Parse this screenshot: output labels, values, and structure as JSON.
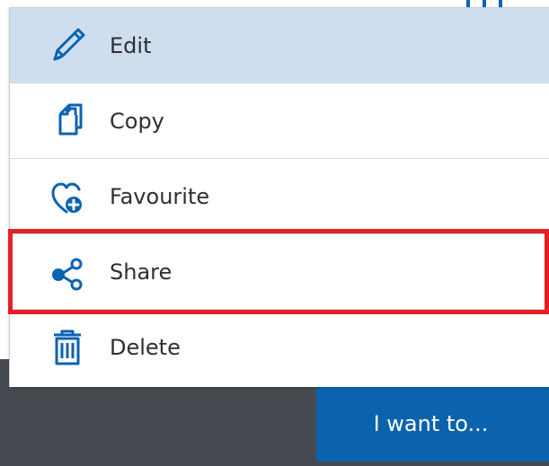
{
  "menu": {
    "items": [
      {
        "label": "Edit",
        "icon": "pencil-icon"
      },
      {
        "label": "Copy",
        "icon": "copy-icon"
      },
      {
        "label": "Favourite",
        "icon": "heart-plus-icon"
      },
      {
        "label": "Share",
        "icon": "share-icon"
      },
      {
        "label": "Delete",
        "icon": "trash-icon"
      }
    ]
  },
  "action_button": {
    "label": "I want to..."
  },
  "colors": {
    "accent": "#0a63b3",
    "button": "#0b63ad",
    "active_row": "#cfdeef",
    "highlight": "#e61f26",
    "footer": "#454950"
  }
}
